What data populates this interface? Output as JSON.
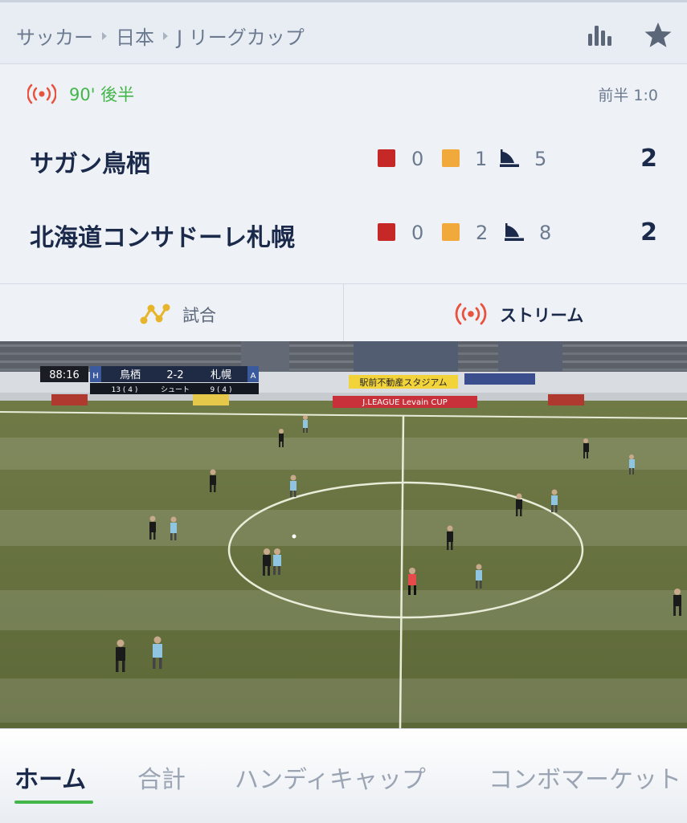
{
  "breadcrumb": {
    "sport": "サッカー",
    "country": "日本",
    "league": "J リーグカップ"
  },
  "header_icons": {
    "stats": "stats-bars-icon",
    "favorite": "star-icon"
  },
  "match": {
    "status_icon": "live-broadcast-icon",
    "minute": "90' 後半",
    "halftime_score": "前半 1:0",
    "teams": [
      {
        "name": "サガン鳥栖",
        "red_cards": "0",
        "yellow_cards": "1",
        "corners": "5",
        "score": "2"
      },
      {
        "name": "北海道コンサドーレ札幌",
        "red_cards": "0",
        "yellow_cards": "2",
        "corners": "8",
        "score": "2"
      }
    ]
  },
  "tabs": {
    "match": "試合",
    "stream": "ストリーム"
  },
  "video_overlay": {
    "clock": "88:16",
    "home_tag": "H",
    "home": "鳥栖",
    "score": "2-2",
    "away": "札幌",
    "away_tag": "A",
    "shots_home": "13 ( 4 )",
    "shots_label": "シュート",
    "shots_away": "9 ( 4 )",
    "banner": "駅前不動産スタジアム",
    "ad_board": "J.LEAGUE Levain CUP"
  },
  "markets": [
    "ホーム",
    "合計",
    "ハンディキャップ",
    "コンボマーケット"
  ],
  "colors": {
    "accent_green": "#43b649",
    "red_card": "#c62828",
    "yellow_card": "#f2a93b",
    "live_red": "#e8523f",
    "navy": "#1b2a4a"
  }
}
